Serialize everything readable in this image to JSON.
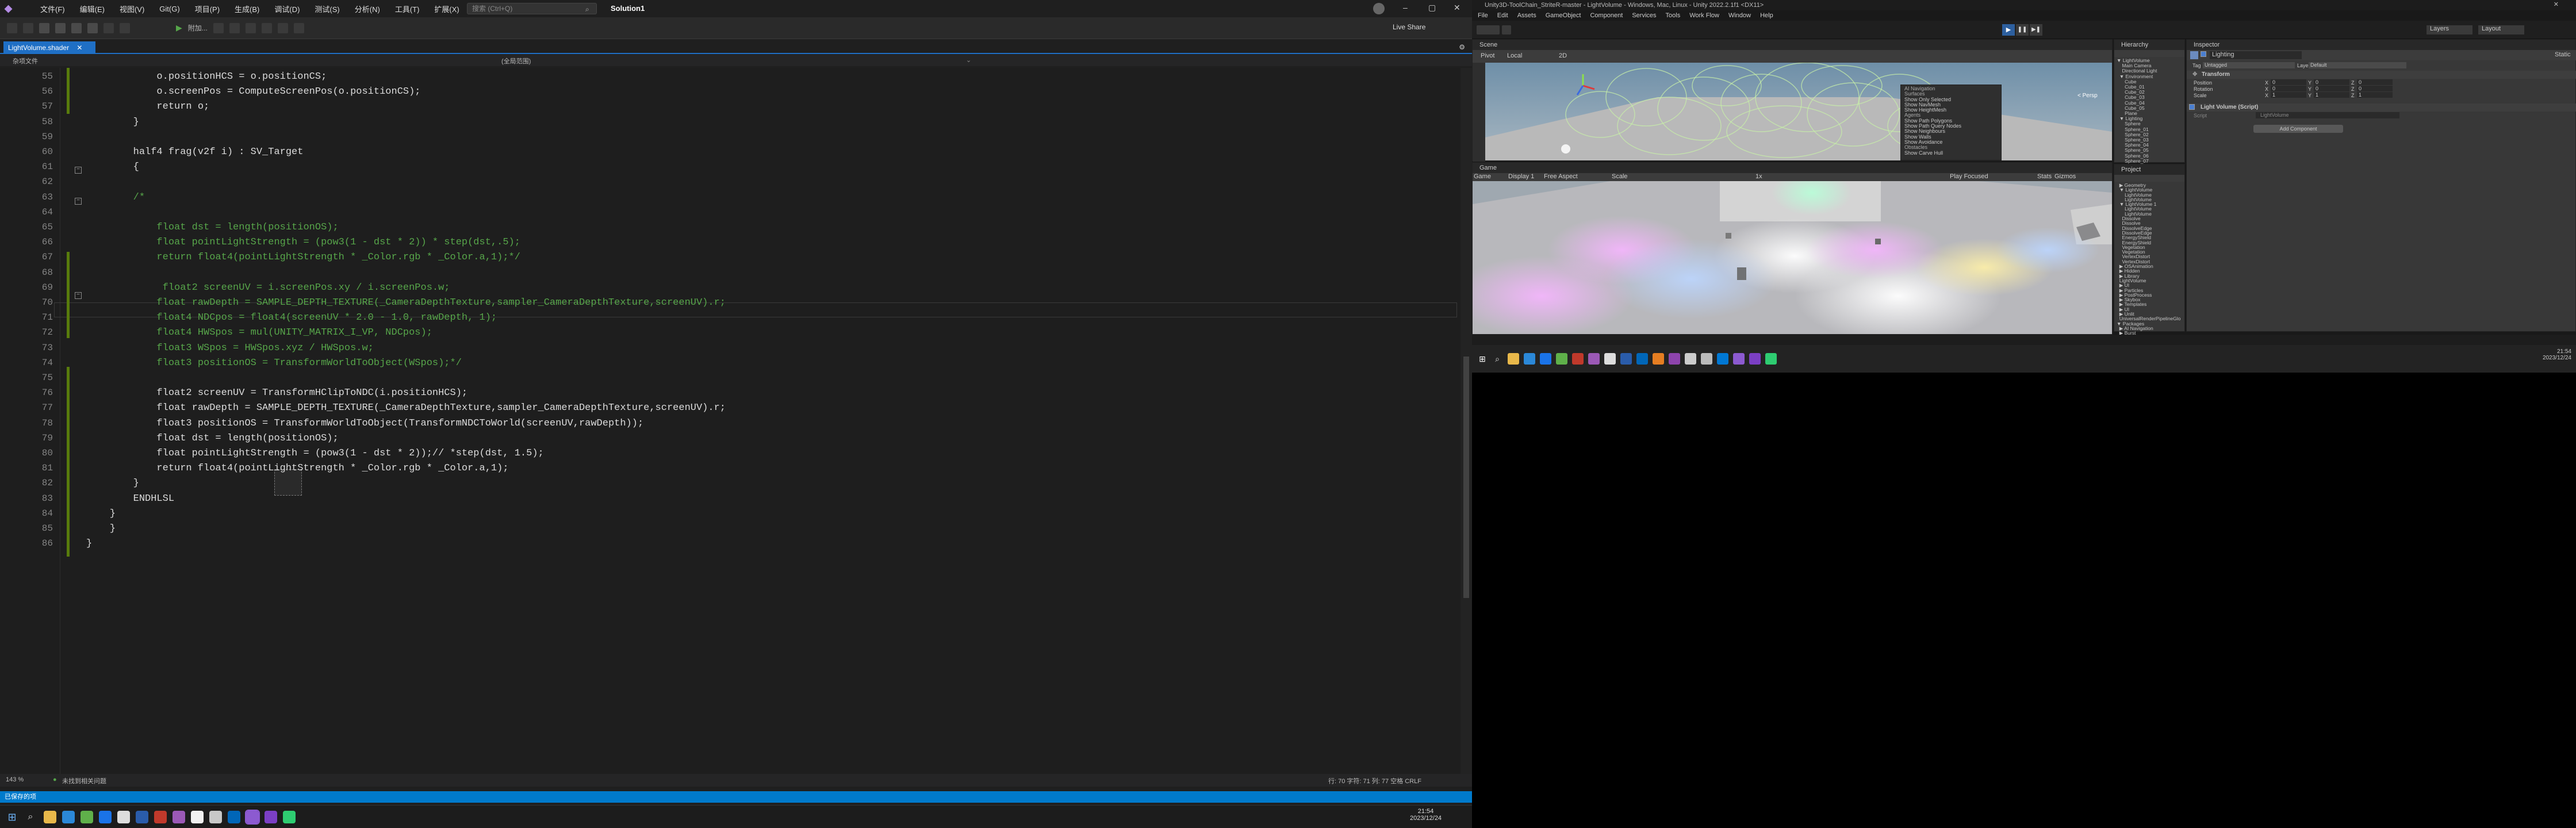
{
  "vs": {
    "menu": [
      "文件(F)",
      "编辑(E)",
      "视图(V)",
      "Git(G)",
      "项目(P)",
      "生成(B)",
      "调试(D)",
      "测试(S)",
      "分析(N)",
      "工具(T)",
      "扩展(X)",
      "窗口(W)",
      "帮助(H)"
    ],
    "search_placeholder": "搜索 (Ctrl+Q)",
    "solution": "Solution1",
    "live_share": "Live Share",
    "toolbar_attach": "附加...",
    "tab_name": "LightVolume.shader",
    "nav_left": "杂项文件",
    "nav_right": "(全局范围)",
    "lines": [
      {
        "n": "55",
        "t": "            o.positionHCS = o.positionCS;",
        "c": "#dcdcdc"
      },
      {
        "n": "56",
        "t": "            o.screenPos = ComputeScreenPos(o.positionCS);",
        "c": "#dcdcdc"
      },
      {
        "n": "57",
        "t": "            return o;",
        "c": "#dcdcdc"
      },
      {
        "n": "58",
        "t": "        }",
        "c": "#dcdcdc"
      },
      {
        "n": "59",
        "t": "",
        "c": "#dcdcdc"
      },
      {
        "n": "60",
        "t": "        half4 frag(v2f i) : SV_Target",
        "c": "#dcdcdc"
      },
      {
        "n": "61",
        "t": "        {",
        "c": "#dcdcdc"
      },
      {
        "n": "62",
        "t": "",
        "c": "#dcdcdc"
      },
      {
        "n": "63",
        "t": "        /*",
        "c": "#57a64a"
      },
      {
        "n": "64",
        "t": "",
        "c": "#57a64a"
      },
      {
        "n": "65",
        "t": "            float dst = length(positionOS);",
        "c": "#57a64a"
      },
      {
        "n": "66",
        "t": "            float pointLightStrength = (pow3(1 - dst * 2)) * step(dst,.5);",
        "c": "#57a64a"
      },
      {
        "n": "67",
        "t": "            return float4(pointLightStrength * _Color.rgb * _Color.a,1);*/",
        "c": "#57a64a"
      },
      {
        "n": "68",
        "t": "",
        "c": "#57a64a"
      },
      {
        "n": "69",
        "t": "             float2 screenUV = i.screenPos.xy / i.screenPos.w;",
        "c": "#57a64a"
      },
      {
        "n": "70",
        "t": "            float rawDepth = SAMPLE_DEPTH_TEXTURE(_CameraDepthTexture,sampler_CameraDepthTexture,screenUV).r;",
        "c": "#57a64a"
      },
      {
        "n": "71",
        "t": "            float4 NDCpos = float4(screenUV * 2.0 - 1.0, rawDepth, 1);",
        "c": "#57a64a"
      },
      {
        "n": "72",
        "t": "            float4 HWSpos = mul(UNITY_MATRIX_I_VP, NDCpos);",
        "c": "#57a64a"
      },
      {
        "n": "73",
        "t": "            float3 WSpos = HWSpos.xyz / HWSpos.w;",
        "c": "#57a64a"
      },
      {
        "n": "74",
        "t": "            float3 positionOS = TransformWorldToObject(WSpos);*/",
        "c": "#57a64a"
      },
      {
        "n": "75",
        "t": "",
        "c": "#dcdcdc"
      },
      {
        "n": "76",
        "t": "            float2 screenUV = TransformHClipToNDC(i.positionHCS);",
        "c": "#dcdcdc"
      },
      {
        "n": "77",
        "t": "            float rawDepth = SAMPLE_DEPTH_TEXTURE(_CameraDepthTexture,sampler_CameraDepthTexture,screenUV).r;",
        "c": "#dcdcdc"
      },
      {
        "n": "78",
        "t": "            float3 positionOS = TransformWorldToObject(TransformNDCToWorld(screenUV,rawDepth));",
        "c": "#dcdcdc"
      },
      {
        "n": "79",
        "t": "            float dst = length(positionOS);",
        "c": "#dcdcdc"
      },
      {
        "n": "80",
        "t": "            float pointLightStrength = (pow3(1 - dst * 2));// *step(dst, 1.5);",
        "c": "#dcdcdc"
      },
      {
        "n": "81",
        "t": "            return float4(pointLightStrength * _Color.rgb * _Color.a,1);",
        "c": "#dcdcdc"
      },
      {
        "n": "82",
        "t": "        }",
        "c": "#dcdcdc"
      },
      {
        "n": "83",
        "t": "        ENDHLSL",
        "c": "#dcdcdc"
      },
      {
        "n": "84",
        "t": "    }",
        "c": "#dcdcdc"
      },
      {
        "n": "85",
        "t": "    }",
        "c": "#dcdcdc"
      },
      {
        "n": "86",
        "t": "}",
        "c": "#dcdcdc"
      },
      {
        "n": "",
        "t": "",
        "c": "#dcdcdc"
      }
    ],
    "status_zoom": "143 %",
    "status_issues": "未找到相关问题",
    "status_pos": "行: 70   字符: 71   列: 77   空格   CRLF",
    "output": "已保存的项",
    "clock_time": "21:54",
    "clock_date": "2023/12/24"
  },
  "unity": {
    "title": "Unity3D-ToolChain_StriteR-master - LightVolume - Windows, Mac, Linux - Unity 2022.2.1f1 <DX11>",
    "menu": [
      "File",
      "Edit",
      "Assets",
      "GameObject",
      "Component",
      "Services",
      "Tools",
      "Work Flow",
      "Window",
      "Help"
    ],
    "toolbar": {
      "layers": "Layers",
      "layout": "Layout"
    },
    "scene_tab": "Scene",
    "scene_tools": [
      "Pivot",
      "Local",
      "2D"
    ],
    "persp": "< Persp",
    "ai_nav": {
      "title": "AI Navigation",
      "surfaces": "Surfaces",
      "items1": [
        "Show Only Selected",
        "Show NavMesh",
        "Show HeightMesh"
      ],
      "agents": "Agents",
      "items2": [
        "Show Path Polygons",
        "Show Path Query Nodes",
        "Show Neighbours",
        "Show Walls",
        "Show Avoidance"
      ],
      "obstacles": "Obstacles",
      "items3": [
        "Show Carve Hull"
      ]
    },
    "game_tab": "Game",
    "game_bar": {
      "mode": "Game",
      "display": "Display 1",
      "aspect": "Free Aspect",
      "scale": "Scale",
      "scale_val": "1x",
      "play": "Play Focused",
      "stats": "Stats",
      "gizmos": "Gizmos"
    },
    "hierarchy_tab": "Hierarchy",
    "hierarchy": [
      "▼ LightVolume",
      "    Main Camera",
      "    Directional Light",
      "  ▼ Environment",
      "      Cube",
      "      Cube_01",
      "      Cube_02",
      "      Cube_03",
      "      Cube_04",
      "      Cube_05",
      "      Plane",
      "  ▼ Lighting",
      "      Sphere",
      "      Sphere_01",
      "      Sphere_02",
      "      Sphere_03",
      "      Sphere_04",
      "      Sphere_05",
      "      Sphere_06",
      "      Sphere_07"
    ],
    "project_tab": "Project",
    "project": [
      "  ▶ Geometry",
      "  ▼ LightVolume",
      "      LightVolume",
      "      LightVolume",
      "  ▼ LightVolume 1",
      "      LightVolume",
      "      LightVolume",
      "    Dissolve",
      "    Dissolve",
      "    DissolveEdge",
      "    DissolveEdge",
      "    EnergyShield",
      "    EnergyShield",
      "    Vegetation",
      "    Vegetation",
      "    VertexDistort",
      "    VertexDistort",
      "  ▶ OSAnimation",
      "  ▶ Hidden",
      "  ▶ Library",
      "  LightVolume",
      "  ▶ UI",
      "  ▶ Particles",
      "  ▶ PostProcess",
      "  ▶ Skybox",
      "  ▶ Templates",
      "  ▶ UI",
      "  ▶ Unlit",
      "  UniversalRenderPipelineGlo",
      "▼ Packages",
      "  ▶ AI Navigation",
      "  ▶ Burst"
    ],
    "inspector_tab": "Inspector",
    "inspector": {
      "name": "Lighting",
      "static": "Static",
      "tag_label": "Tag",
      "tag": "Untagged",
      "layer_label": "Layer",
      "layer": "Default",
      "transform": "Transform",
      "position": "Position",
      "rotation": "Rotation",
      "scale": "Scale",
      "x": "X",
      "y": "Y",
      "z": "Z",
      "pos_vals": [
        "0",
        "0",
        "0"
      ],
      "rot_vals": [
        "0",
        "0",
        "0"
      ],
      "scale_vals": [
        "1",
        "1",
        "1"
      ],
      "script_comp": "Light Volume (Script)",
      "script_label": "Script",
      "script_val": "LightVolume",
      "add_component": "Add Component"
    },
    "clock_time": "21:54",
    "clock_date": "2023/12/24"
  }
}
